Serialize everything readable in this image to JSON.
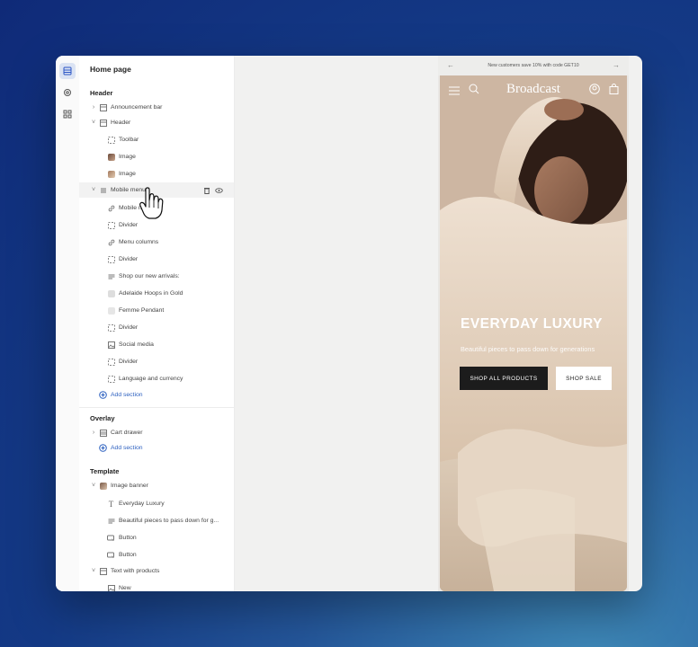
{
  "sidebar": {
    "title": "Home page",
    "header_group": "Header",
    "overlay_group": "Overlay",
    "template_group": "Template",
    "rows": [
      {
        "label": "Announcement bar",
        "icon": "section-icon"
      },
      {
        "label": "Header",
        "icon": "section-icon"
      },
      {
        "label": "Toolbar",
        "icon": "block-icon"
      },
      {
        "label": "Image",
        "icon": "image-thumb-icon"
      },
      {
        "label": "Image",
        "icon": "image-thumb-icon"
      },
      {
        "label": "Mobile menu",
        "icon": "menu-icon"
      },
      {
        "label": "Mobile menu",
        "icon": "link-icon"
      },
      {
        "label": "Divider",
        "icon": "block-icon"
      },
      {
        "label": "Menu columns",
        "icon": "link-icon"
      },
      {
        "label": "Divider",
        "icon": "block-icon"
      },
      {
        "label": "Shop our new arrivals:",
        "icon": "text-icon"
      },
      {
        "label": "Adelaide Hoops in Gold",
        "icon": "product-icon"
      },
      {
        "label": "Femme Pendant",
        "icon": "product-icon"
      },
      {
        "label": "Divider",
        "icon": "block-icon"
      },
      {
        "label": "Social media",
        "icon": "image-icon"
      },
      {
        "label": "Divider",
        "icon": "block-icon"
      },
      {
        "label": "Language and currency",
        "icon": "block-icon"
      },
      {
        "label": "Add section",
        "icon": "plus-circle-icon"
      },
      {
        "label": "Cart drawer",
        "icon": "section-icon"
      },
      {
        "label": "Add section",
        "icon": "plus-circle-icon"
      },
      {
        "label": "Image banner",
        "icon": "image-thumb-icon"
      },
      {
        "label": "Everyday Luxury",
        "icon": "heading-icon"
      },
      {
        "label": "Beautiful pieces to pass down for g...",
        "icon": "text-icon"
      },
      {
        "label": "Button",
        "icon": "button-icon"
      },
      {
        "label": "Button",
        "icon": "button-icon"
      },
      {
        "label": "Text with products",
        "icon": "section-icon"
      },
      {
        "label": "New",
        "icon": "image-icon"
      }
    ]
  },
  "preview": {
    "announcement": "New customers save 10% with code GET10",
    "brand": "Broadcast",
    "headline": "EVERYDAY LUXURY",
    "subheading": "Beautiful pieces to pass down for generations",
    "primary_button": "SHOP ALL PRODUCTS",
    "secondary_button": "SHOP SALE"
  },
  "colors": {
    "accent": "#2b5fbf",
    "background_top": "#0f2a78",
    "background_bottom": "#3f8ab8"
  }
}
